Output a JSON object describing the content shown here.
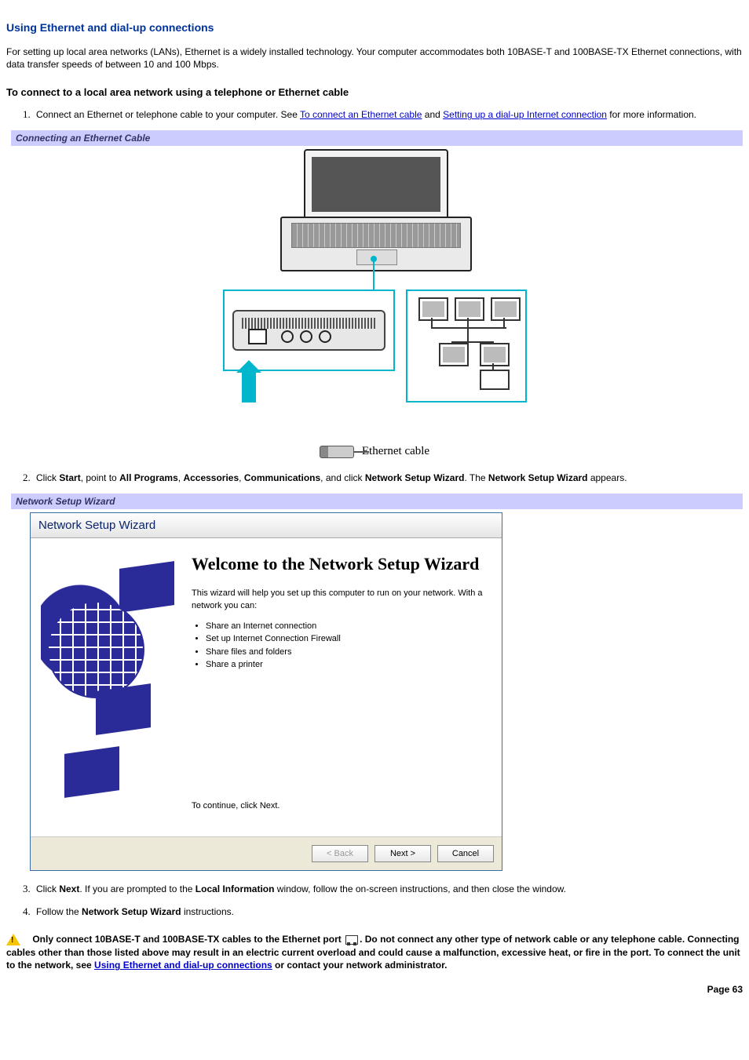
{
  "section_title": "Using Ethernet and dial-up connections",
  "intro": "For setting up local area networks (LANs), Ethernet is a widely installed technology. Your computer accommodates both 10BASE-T and 100BASE-TX Ethernet connections, with data transfer speeds of between 10 and 100 Mbps.",
  "sub_heading": "To connect to a local area network using a telephone or Ethernet cable",
  "step1": {
    "pre": "Connect an Ethernet or telephone cable to your computer. See ",
    "link1": "To connect an Ethernet cable",
    "mid": " and ",
    "link2": "Setting up a dial-up Internet connection",
    "post": " for more information."
  },
  "caption1": "Connecting an Ethernet Cable",
  "fig1_label": "Ethernet cable",
  "step2": {
    "t1": "Click ",
    "b1": "Start",
    "t2": ", point to ",
    "b2": "All Programs",
    "t3": ", ",
    "b3": "Accessories",
    "t4": ", ",
    "b4": "Communications",
    "t5": ", and click ",
    "b5": "Network Setup Wizard",
    "t6": ". The ",
    "b6": "Network Setup Wizard",
    "t7": " appears."
  },
  "caption2": "Network Setup Wizard",
  "wizard": {
    "title": "Network Setup Wizard",
    "heading": "Welcome to the Network Setup Wizard",
    "desc": "This wizard will help you set up this computer to run on your network. With a network you can:",
    "bullets": [
      "Share an Internet connection",
      "Set up Internet Connection Firewall",
      "Share files and folders",
      "Share a printer"
    ],
    "continue": "To continue, click Next.",
    "back": "< Back",
    "next": "Next >",
    "cancel": "Cancel"
  },
  "step3": {
    "t1": "Click ",
    "b1": "Next",
    "t2": ". If you are prompted to the ",
    "b2": "Local Information",
    "t3": " window, follow the on-screen instructions, and then close the window."
  },
  "step4": {
    "t1": "Follow the ",
    "b1": "Network Setup Wizard",
    "t2": " instructions."
  },
  "warning": {
    "t1": "Only connect 10BASE-T and 100BASE-TX cables to the Ethernet port ",
    "t2": ". Do not connect any other type of network cable or any telephone cable. Connecting cables other than those listed above may result in an electric current overload and could cause a malfunction, excessive heat, or fire in the port. To connect the unit to the network, see ",
    "link": "Using Ethernet and dial-up connections",
    "t3": " or contact your network administrator."
  },
  "page_number": "Page 63"
}
